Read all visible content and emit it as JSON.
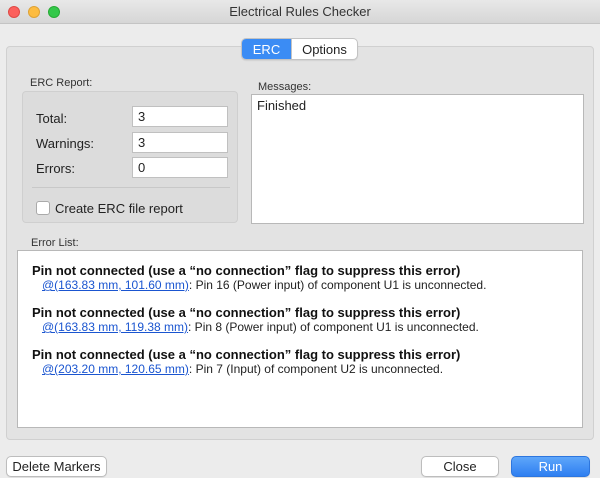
{
  "window": {
    "title": "Electrical Rules Checker"
  },
  "tabs": [
    {
      "label": "ERC",
      "active": true
    },
    {
      "label": "Options",
      "active": false
    }
  ],
  "report": {
    "section_label": "ERC Report:",
    "total_label": "Total:",
    "total_value": "3",
    "warnings_label": "Warnings:",
    "warnings_value": "3",
    "errors_label": "Errors:",
    "errors_value": "0",
    "checkbox_label": "Create ERC file report",
    "checkbox_checked": false
  },
  "messages": {
    "label": "Messages:",
    "text": "Finished"
  },
  "error_list": {
    "label": "Error List:",
    "items": [
      {
        "title": "Pin not connected (use a “no connection” flag to suppress this error)",
        "link": "@(163.83 mm, 101.60 mm)",
        "detail": ": Pin 16 (Power input) of component U1 is unconnected."
      },
      {
        "title": "Pin not connected (use a “no connection” flag to suppress this error)",
        "link": "@(163.83 mm, 119.38 mm)",
        "detail": ": Pin 8 (Power input) of component U1 is unconnected."
      },
      {
        "title": "Pin not connected (use a “no connection” flag to suppress this error)",
        "link": "@(203.20 mm, 120.65 mm)",
        "detail": ": Pin 7 (Input) of component U2 is unconnected."
      }
    ]
  },
  "buttons": {
    "delete_markers": "Delete Markers",
    "close": "Close",
    "run": "Run"
  },
  "colors": {
    "accent": "#3b8cf4",
    "link": "#1a55d0"
  }
}
